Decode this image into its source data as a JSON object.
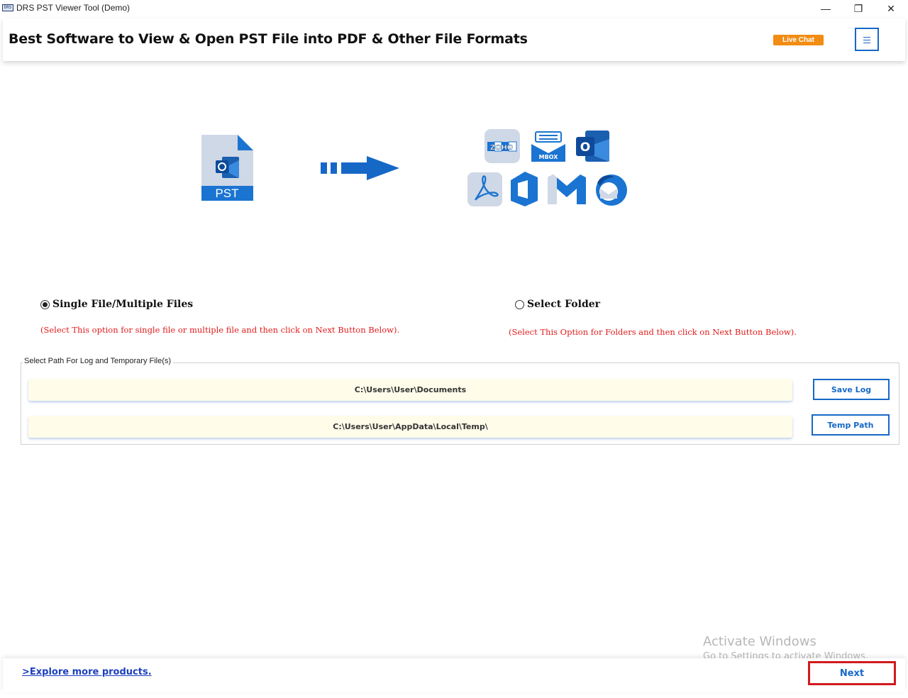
{
  "window": {
    "title": "DRS PST Viewer Tool (Demo)",
    "app_icon_text": "DRS",
    "minimize": "—",
    "maximize": "❐",
    "close": "✕"
  },
  "header": {
    "title": "Best Software to View & Open PST File into PDF & Other File Formats",
    "live_chat": "Live Chat",
    "menu_icon": "hamburger-icon"
  },
  "illustration": {
    "source_label": "PST",
    "arrow_icon": "right-arrow-icon",
    "target_icons": [
      "zoho-icon",
      "mbox-icon",
      "outlook-icon",
      "pdf-icon",
      "office365-icon",
      "gmail-icon",
      "thunderbird-icon"
    ],
    "zoho_text": "ZOHO",
    "mbox_text": "MBOX",
    "outlook_letter": "O"
  },
  "options": {
    "single": {
      "label": "Single File/Multiple Files",
      "checked": true,
      "hint": "(Select This option for single file or multiple file and then click on Next Button Below)."
    },
    "folder": {
      "label": "Select Folder",
      "checked": false,
      "hint": "(Select This Option for Folders and then click on Next Button Below)."
    }
  },
  "paths": {
    "group_label": "Select Path For Log and Temporary File(s)",
    "log_path": "C:\\Users\\User\\Documents",
    "temp_path": "C:\\Users\\User\\AppData\\Local\\Temp\\",
    "save_log_label": "Save Log",
    "temp_path_label": "Temp Path"
  },
  "footer": {
    "explore": ">Explore more products.",
    "next": "Next"
  },
  "watermark": {
    "line1": "Activate Windows",
    "line2": "Go to Settings to activate Windows."
  },
  "colors": {
    "accent_blue": "#1668c7",
    "live_chat_orange": "#f28c12",
    "hint_red": "#e21b1b",
    "next_highlight_red": "#d11a1f"
  }
}
